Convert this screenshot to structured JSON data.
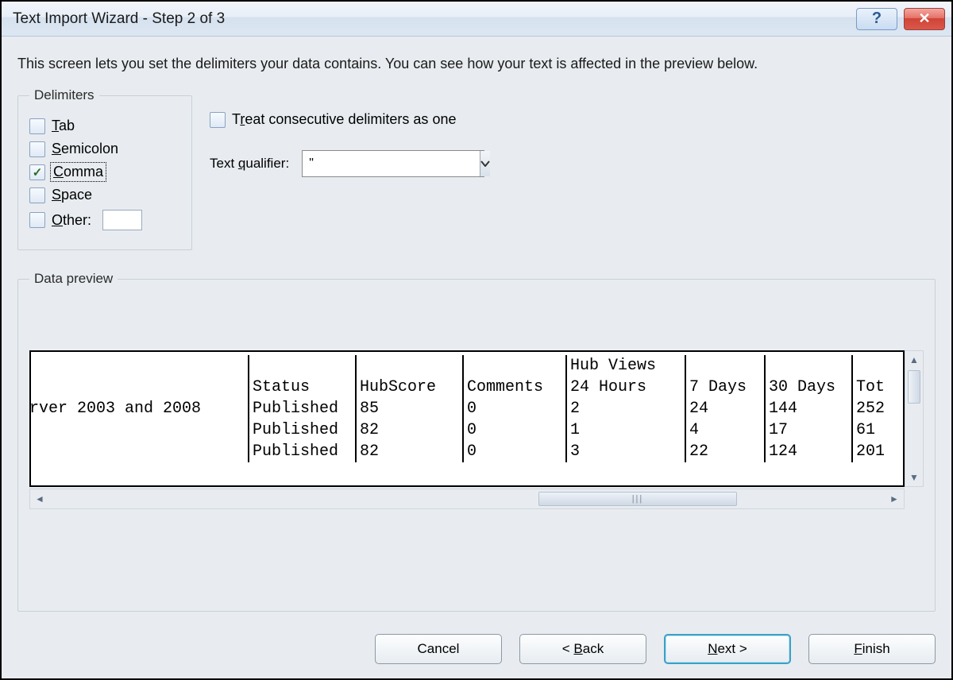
{
  "title": "Text Import Wizard - Step 2 of 3",
  "instruction": "This screen lets you set the delimiters your data contains.  You can see how your text is affected in the preview below.",
  "delimiters": {
    "legend": "Delimiters",
    "tab": {
      "label": "Tab",
      "checked": false
    },
    "semicolon": {
      "label": "Semicolon",
      "checked": false
    },
    "comma": {
      "label": "Comma",
      "checked": true
    },
    "space": {
      "label": "Space",
      "checked": false
    },
    "other": {
      "label": "Other:",
      "checked": false,
      "value": ""
    }
  },
  "treat_consecutive": {
    "label": "Treat consecutive delimiters as one",
    "checked": false
  },
  "text_qualifier": {
    "label": "Text qualifier:",
    "value": "\""
  },
  "preview": {
    "legend": "Data preview",
    "headers_extra_top": [
      "",
      "",
      "",
      "",
      "Hub Views",
      "",
      "",
      ""
    ],
    "headers": [
      "",
      "Status",
      "HubScore",
      "Comments",
      "24 Hours",
      "7 Days",
      "30 Days",
      "Tot"
    ],
    "rows": [
      [
        "rver 2003 and 2008",
        "Published",
        "85",
        "0",
        "2",
        "24",
        "144",
        "252"
      ],
      [
        "",
        "Published",
        "82",
        "0",
        "1",
        "4",
        "17",
        "61"
      ],
      [
        "",
        "Published",
        "82",
        "0",
        "3",
        "22",
        "124",
        "201"
      ]
    ]
  },
  "buttons": {
    "cancel": "Cancel",
    "back": "Back",
    "next": "Next",
    "finish": "Finish"
  }
}
